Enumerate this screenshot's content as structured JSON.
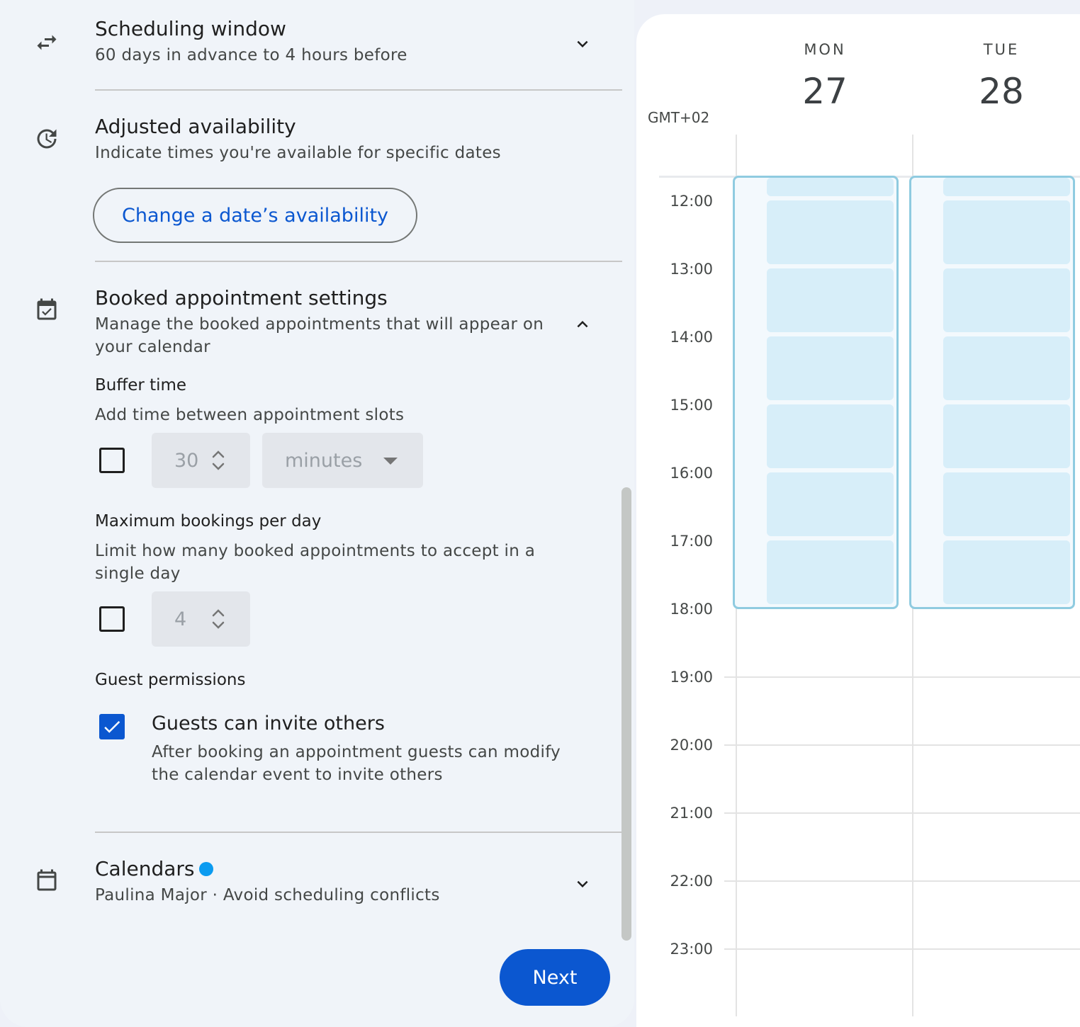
{
  "scheduling_window": {
    "title": "Scheduling window",
    "subtitle": "60 days in advance to 4 hours before",
    "icon": "swap-arrows-icon"
  },
  "adjusted_availability": {
    "title": "Adjusted availability",
    "subtitle": "Indicate times you're available for specific dates",
    "button_label": "Change a date’s availability",
    "icon": "clock-refresh-icon"
  },
  "booked_settings": {
    "title": "Booked appointment settings",
    "subtitle": "Manage the booked appointments that will appear on your calendar",
    "icon": "event-check-icon",
    "buffer": {
      "label": "Buffer time",
      "description": "Add time between appointment slots",
      "checked": false,
      "value": "30",
      "unit": "minutes"
    },
    "max_bookings": {
      "label": "Maximum bookings per day",
      "description": "Limit how many booked appointments to accept in a single day",
      "checked": false,
      "value": "4"
    },
    "guest_permissions": {
      "label": "Guest permissions",
      "option_label": "Guests can invite others",
      "option_description": "After booking an appointment guests can modify the calendar event to invite others",
      "checked": true
    }
  },
  "calendars": {
    "title": "Calendars",
    "subtitle": "Paulina Major · Avoid scheduling conflicts",
    "icon": "calendar-icon",
    "dot_color": "#0b9bf0"
  },
  "next_button": {
    "label": "Next"
  },
  "calendar_view": {
    "timezone": "GMT+02",
    "days": [
      {
        "name": "MON",
        "number": "27"
      },
      {
        "name": "TUE",
        "number": "28"
      }
    ],
    "hours": [
      "12:00",
      "13:00",
      "14:00",
      "15:00",
      "16:00",
      "17:00",
      "18:00",
      "19:00",
      "20:00",
      "21:00",
      "22:00",
      "23:00"
    ],
    "available_range": "12:00 - 18:00",
    "slot_color": "#d7eef9",
    "accent": "#0b57d0"
  }
}
